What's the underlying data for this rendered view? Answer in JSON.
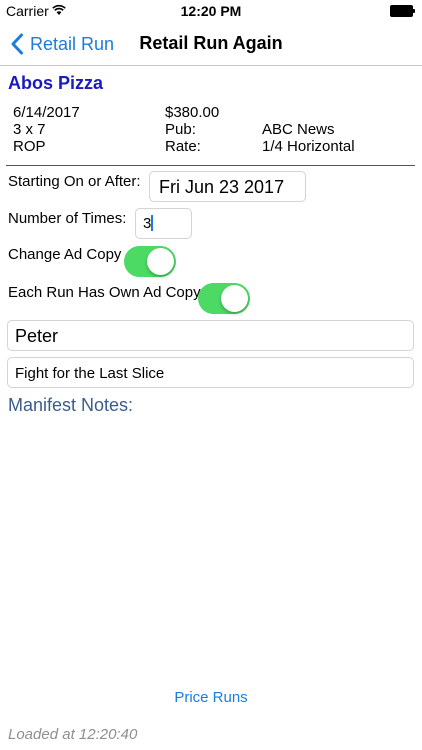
{
  "status_bar": {
    "carrier": "Carrier",
    "time": "12:20 PM"
  },
  "nav": {
    "back_label": "Retail Run",
    "title": "Retail Run Again"
  },
  "client": {
    "name": "Abos Pizza"
  },
  "run_info": {
    "date": "6/14/2017",
    "size": "3 x 7",
    "placement": "ROP",
    "price": "$380.00",
    "pub_label": "Pub:",
    "pub_value": "ABC News",
    "rate_label": "Rate:",
    "rate_value": "1/4 Horizontal"
  },
  "form": {
    "starting_label": "Starting On or After:",
    "starting_value": "Fri Jun 23 2017",
    "times_label": "Number of Times:",
    "times_value": "3",
    "change_copy_label": "Change Ad Copy",
    "change_copy_on": true,
    "own_copy_label": "Each Run Has Own Ad Copy",
    "own_copy_on": true,
    "name_value": "Peter",
    "copy_value": "Fight for the Last Slice",
    "manifest_label": "Manifest Notes:"
  },
  "footer": {
    "price_runs_label": "Price Runs",
    "loaded_at": "Loaded at 12:20:40"
  },
  "colors": {
    "accent": "#1b7ce0",
    "toggle_on": "#4cd964",
    "client_name": "#1a1abf",
    "manifest": "#3a5d8c"
  }
}
